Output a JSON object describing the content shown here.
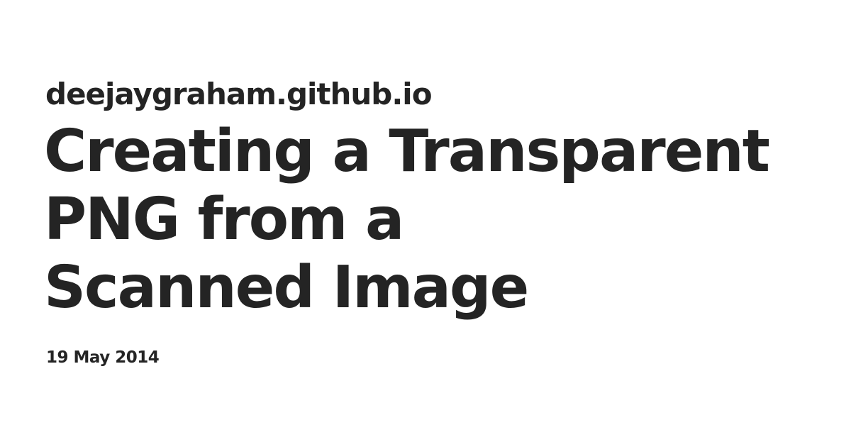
{
  "site": {
    "name": "deejaygraham.github.io"
  },
  "post": {
    "title_lines": [
      "Creating a Transparent",
      "PNG from a",
      "Scanned Image"
    ],
    "date": "19 May 2014"
  },
  "colors": {
    "background": "#ffffff",
    "text": "#242424"
  }
}
